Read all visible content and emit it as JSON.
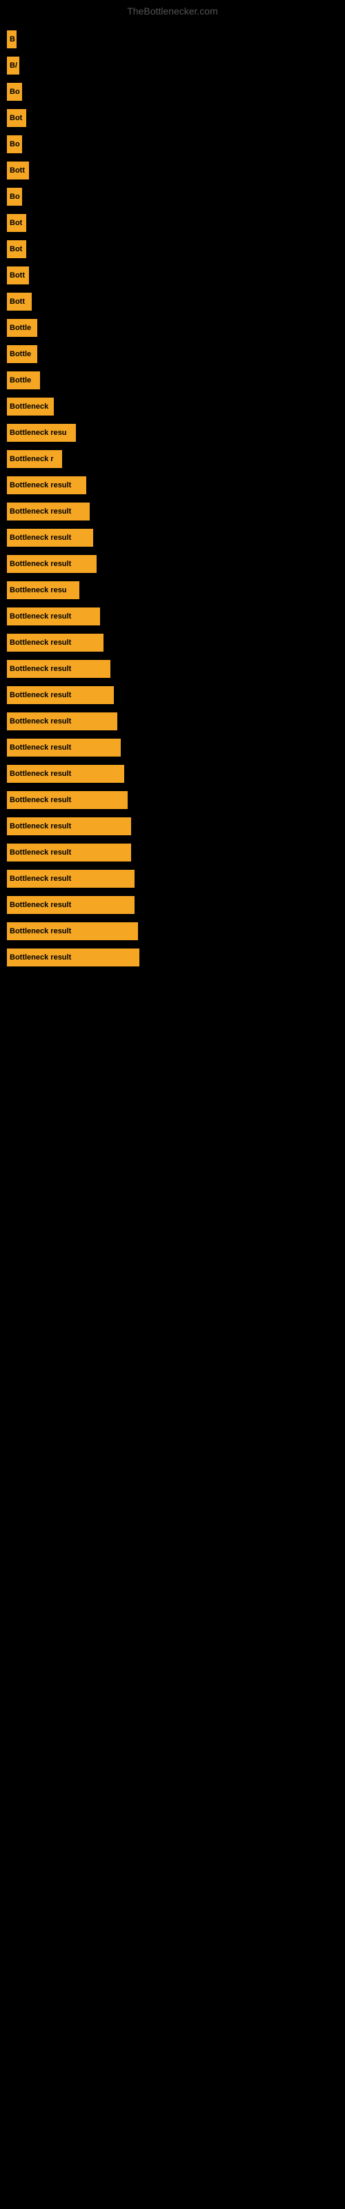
{
  "site": {
    "title": "TheBottlenecker.com"
  },
  "bars": [
    {
      "label": "B",
      "width": 14
    },
    {
      "label": "B/",
      "width": 18
    },
    {
      "label": "Bo",
      "width": 22
    },
    {
      "label": "Bot",
      "width": 28
    },
    {
      "label": "Bo",
      "width": 22
    },
    {
      "label": "Bott",
      "width": 32
    },
    {
      "label": "Bo",
      "width": 22
    },
    {
      "label": "Bot",
      "width": 28
    },
    {
      "label": "Bot",
      "width": 28
    },
    {
      "label": "Bott",
      "width": 32
    },
    {
      "label": "Bott",
      "width": 36
    },
    {
      "label": "Bottle",
      "width": 44
    },
    {
      "label": "Bottle",
      "width": 44
    },
    {
      "label": "Bottle",
      "width": 48
    },
    {
      "label": "Bottleneck",
      "width": 68
    },
    {
      "label": "Bottleneck resu",
      "width": 100
    },
    {
      "label": "Bottleneck r",
      "width": 80
    },
    {
      "label": "Bottleneck result",
      "width": 115
    },
    {
      "label": "Bottleneck result",
      "width": 120
    },
    {
      "label": "Bottleneck result",
      "width": 125
    },
    {
      "label": "Bottleneck result",
      "width": 130
    },
    {
      "label": "Bottleneck resu",
      "width": 105
    },
    {
      "label": "Bottleneck result",
      "width": 135
    },
    {
      "label": "Bottleneck result",
      "width": 140
    },
    {
      "label": "Bottleneck result",
      "width": 150
    },
    {
      "label": "Bottleneck result",
      "width": 155
    },
    {
      "label": "Bottleneck result",
      "width": 160
    },
    {
      "label": "Bottleneck result",
      "width": 165
    },
    {
      "label": "Bottleneck result",
      "width": 170
    },
    {
      "label": "Bottleneck result",
      "width": 175
    },
    {
      "label": "Bottleneck result",
      "width": 180
    },
    {
      "label": "Bottleneck result",
      "width": 180
    },
    {
      "label": "Bottleneck result",
      "width": 185
    },
    {
      "label": "Bottleneck result",
      "width": 185
    },
    {
      "label": "Bottleneck result",
      "width": 190
    },
    {
      "label": "Bottleneck result",
      "width": 192
    }
  ]
}
